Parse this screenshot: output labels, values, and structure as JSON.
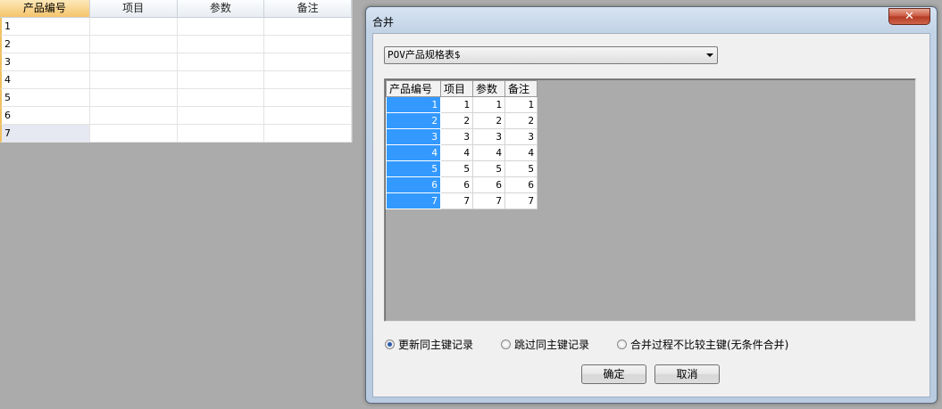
{
  "sheet": {
    "headers": [
      "产品编号",
      "项目",
      "参数",
      "备注"
    ],
    "rows": [
      "1",
      "2",
      "3",
      "4",
      "5",
      "6",
      "7"
    ]
  },
  "dialog": {
    "title": "合并",
    "close_glyph": "✕",
    "combo": {
      "value": "POV产品规格表$"
    },
    "grid": {
      "headers": [
        "产品编号",
        "项目",
        "参数",
        "备注"
      ],
      "rows": [
        [
          "1",
          "1",
          "1",
          "1"
        ],
        [
          "2",
          "2",
          "2",
          "2"
        ],
        [
          "3",
          "3",
          "3",
          "3"
        ],
        [
          "4",
          "4",
          "4",
          "4"
        ],
        [
          "5",
          "5",
          "5",
          "5"
        ],
        [
          "6",
          "6",
          "6",
          "6"
        ],
        [
          "7",
          "7",
          "7",
          "7"
        ]
      ]
    },
    "options": [
      {
        "label": "更新同主键记录",
        "checked": true
      },
      {
        "label": "跳过同主键记录",
        "checked": false
      },
      {
        "label": "合并过程不比较主键(无条件合并)",
        "checked": false
      }
    ],
    "ok_label": "确定",
    "cancel_label": "取消"
  },
  "colors": {
    "selected_key": "#3399ff",
    "active_header": "#f5c46c",
    "close_button": "#c9543d"
  }
}
